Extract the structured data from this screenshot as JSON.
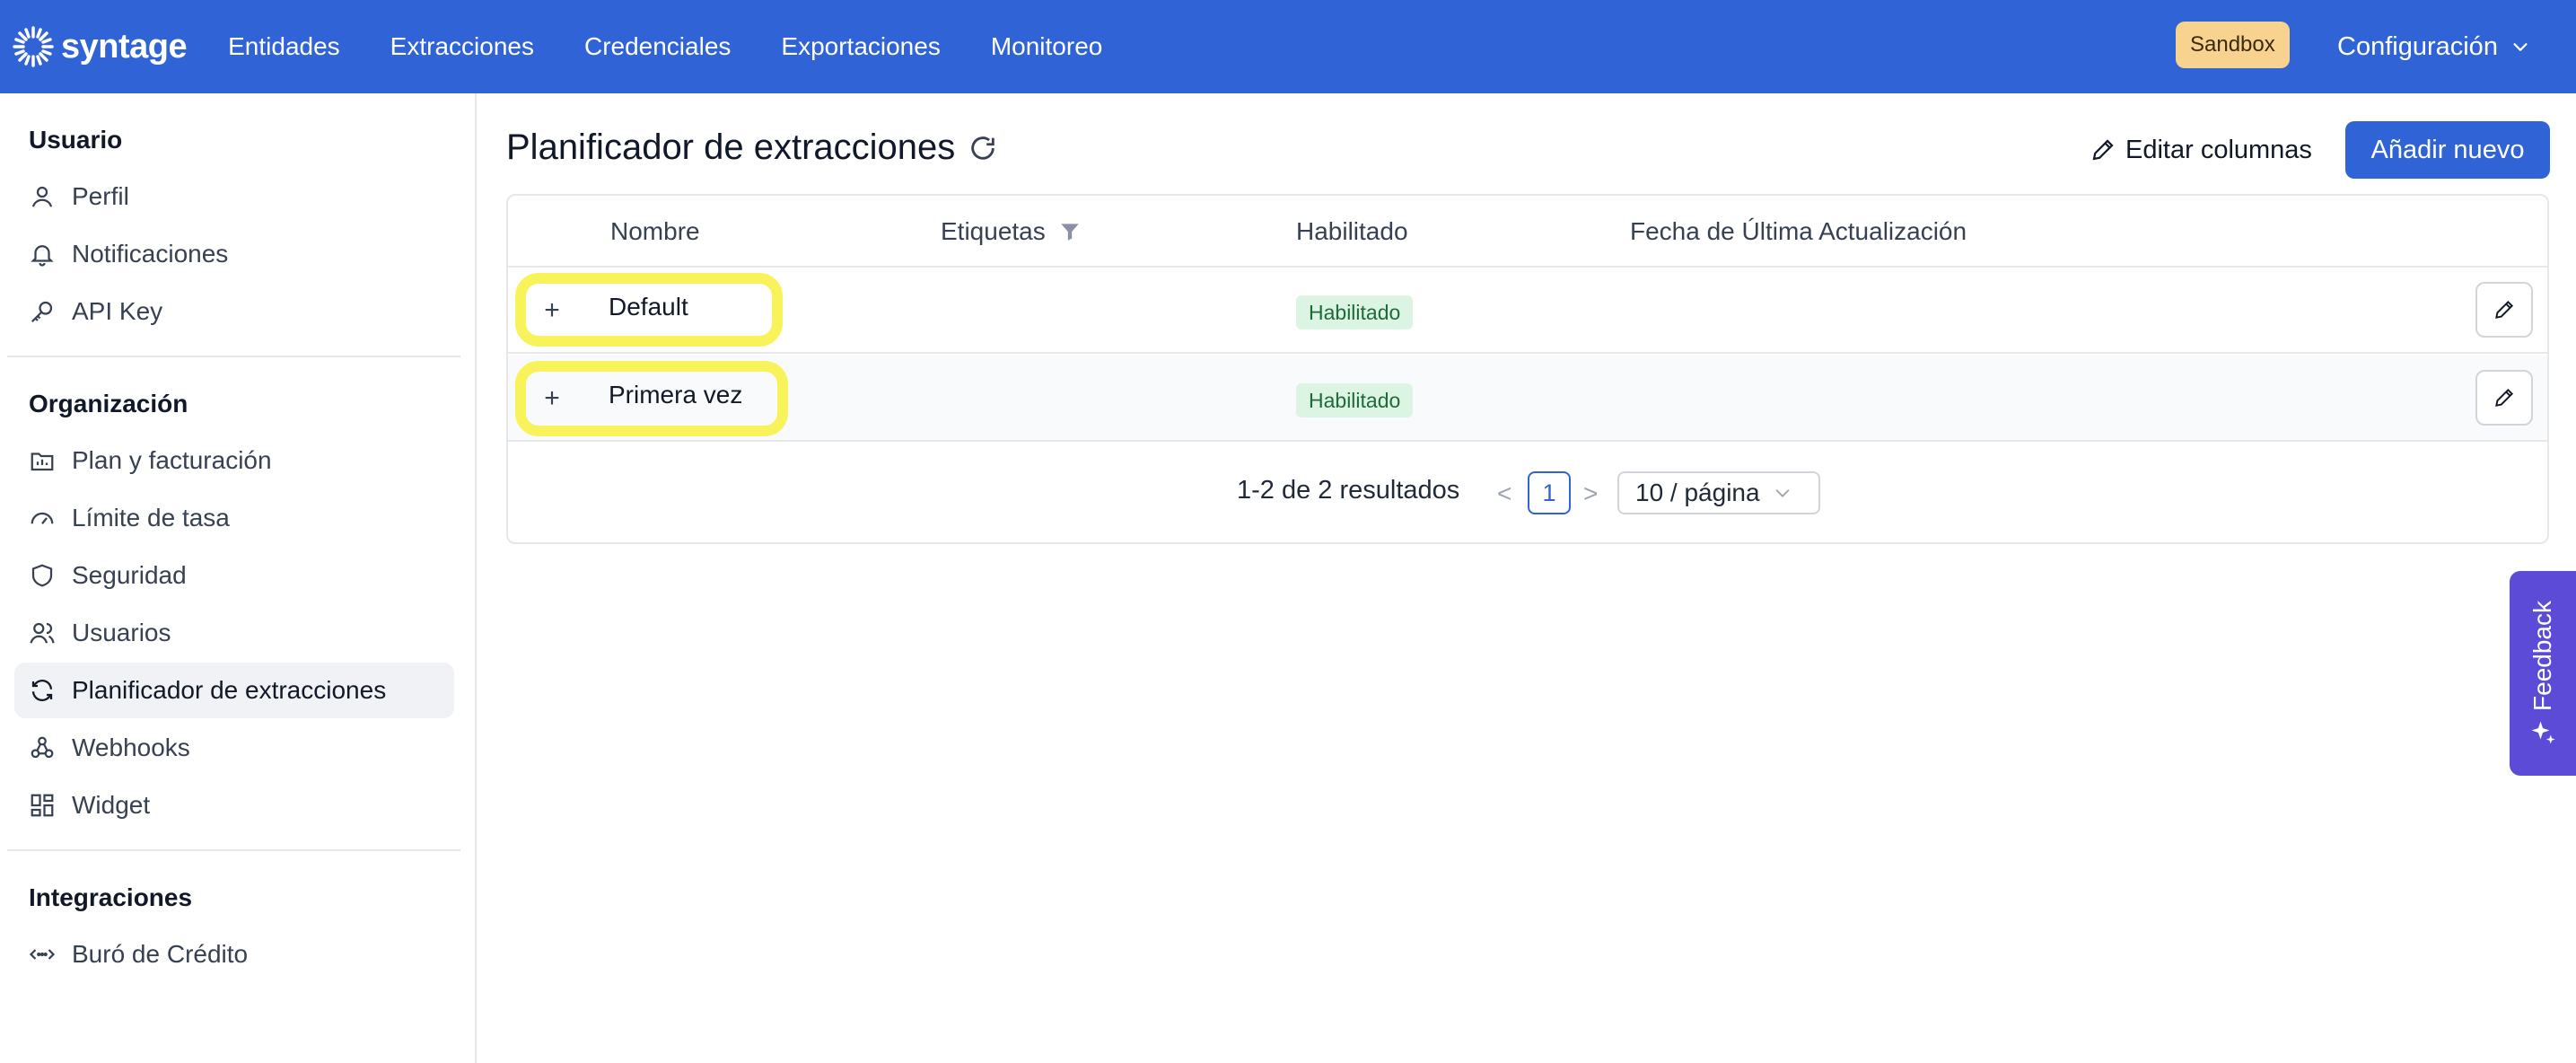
{
  "brand": {
    "name": "syntage"
  },
  "nav": {
    "items": [
      "Entidades",
      "Extracciones",
      "Credenciales",
      "Exportaciones",
      "Monitoreo"
    ],
    "environment_badge": "Sandbox",
    "config_label": "Configuración"
  },
  "sidebar": {
    "sections": [
      {
        "title": "Usuario",
        "items": [
          {
            "label": "Perfil",
            "icon": "user-icon"
          },
          {
            "label": "Notificaciones",
            "icon": "bell-icon"
          },
          {
            "label": "API Key",
            "icon": "key-icon"
          }
        ]
      },
      {
        "title": "Organización",
        "items": [
          {
            "label": "Plan y facturación",
            "icon": "billing-folder-icon"
          },
          {
            "label": "Límite de tasa",
            "icon": "gauge-icon"
          },
          {
            "label": "Seguridad",
            "icon": "shield-icon"
          },
          {
            "label": "Usuarios",
            "icon": "users-icon"
          },
          {
            "label": "Planificador de extracciones",
            "icon": "refresh-icon",
            "active": true
          },
          {
            "label": "Webhooks",
            "icon": "webhook-icon"
          },
          {
            "label": "Widget",
            "icon": "grid-icon"
          }
        ]
      },
      {
        "title": "Integraciones",
        "items": [
          {
            "label": "Buró de Crédito",
            "icon": "arrows-horizontal-icon"
          }
        ]
      }
    ]
  },
  "main": {
    "title": "Planificador de extracciones",
    "edit_columns_label": "Editar columnas",
    "add_new_label": "Añadir nuevo",
    "table": {
      "columns": [
        "Nombre",
        "Etiquetas",
        "Habilitado",
        "Fecha de Última Actualización"
      ],
      "rows": [
        {
          "name": "Default",
          "tags": "",
          "enabled": "Habilitado",
          "updated": ""
        },
        {
          "name": "Primera vez",
          "tags": "",
          "enabled": "Habilitado",
          "updated": ""
        }
      ]
    },
    "pagination": {
      "results": "1-2 de 2 resultados",
      "current_page": "1",
      "page_size": "10 / página",
      "prev": "<",
      "next": ">"
    }
  },
  "feedback": {
    "label": "Feedback"
  },
  "colors": {
    "primary": "#3063d6",
    "badge_bg": "#dcf4e3",
    "highlight": "#f8f35a",
    "feedback": "#5b4bd6"
  }
}
